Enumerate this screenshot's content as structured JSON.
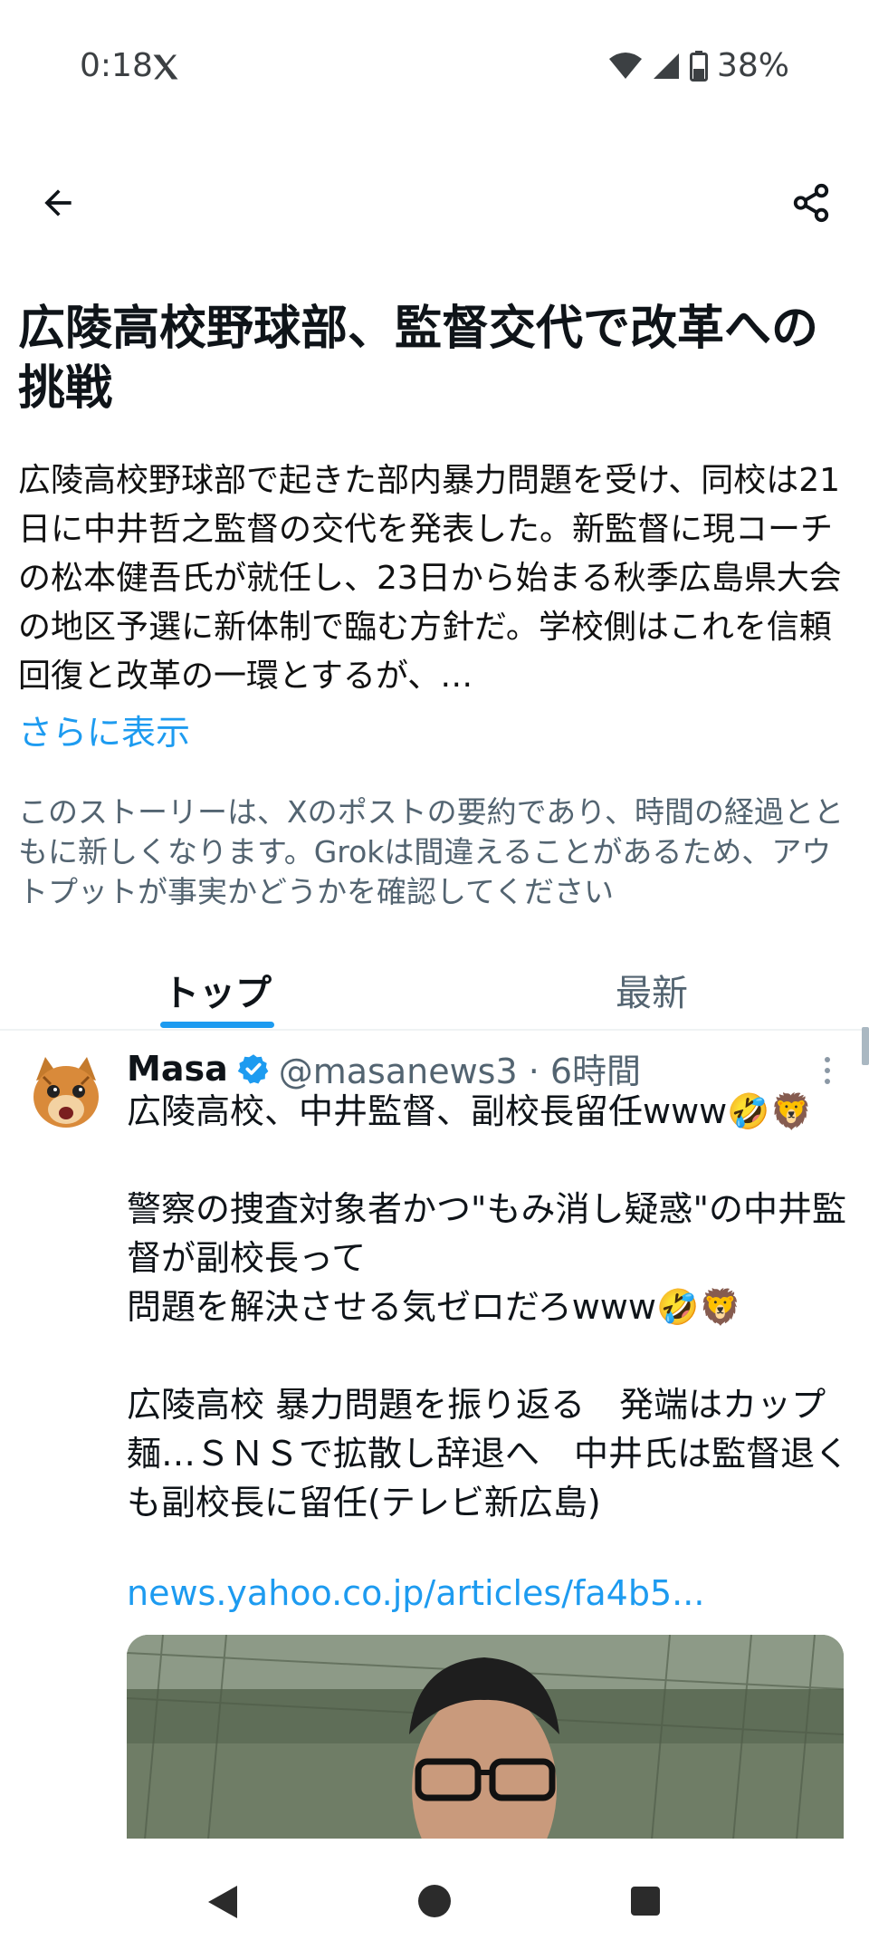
{
  "status_bar": {
    "time": "0:18",
    "battery": "38%"
  },
  "article": {
    "title": "広陵高校野球部、監督交代で改革への挑戦",
    "summary": "広陵高校野球部で起きた部内暴力問題を受け、同校は21日に中井哲之監督の交代を発表した。新監督に現コーチの松本健吾氏が就任し、23日から始まる秋季広島県大会の地区予選に新体制で臨む方針だ。学校側はこれを信頼回復と改革の一環とするが、…",
    "show_more": "さらに表示",
    "disclaimer": "このストーリーは、Xのポストの要約であり、時間の経過とともに新しくなります。Grokは間違えることがあるため、アウトプットが事実かどうかを確認してください"
  },
  "tabs": {
    "top": "トップ",
    "latest": "最新"
  },
  "post": {
    "author_name": "Masa",
    "handle_time": "@masanews3 · 6時間",
    "text": "広陵高校、中井監督、副校長留任www🤣🦁\n\n警察の捜査対象者かつ\"もみ消し疑惑\"の中井監督が副校長って\n問題を解決させる気ゼロだろwww🤣🦁\n\n広陵高校 暴力問題を振り返る　発端はカップ麺…ＳＮＳで拡散し辞退へ　中井氏は監督退くも副校長に留任(テレビ新広島)",
    "link": "news.yahoo.co.jp/articles/fa4b5..."
  },
  "colors": {
    "accent": "#1d9bf0",
    "text": "#0f1419",
    "secondary": "#536471"
  }
}
